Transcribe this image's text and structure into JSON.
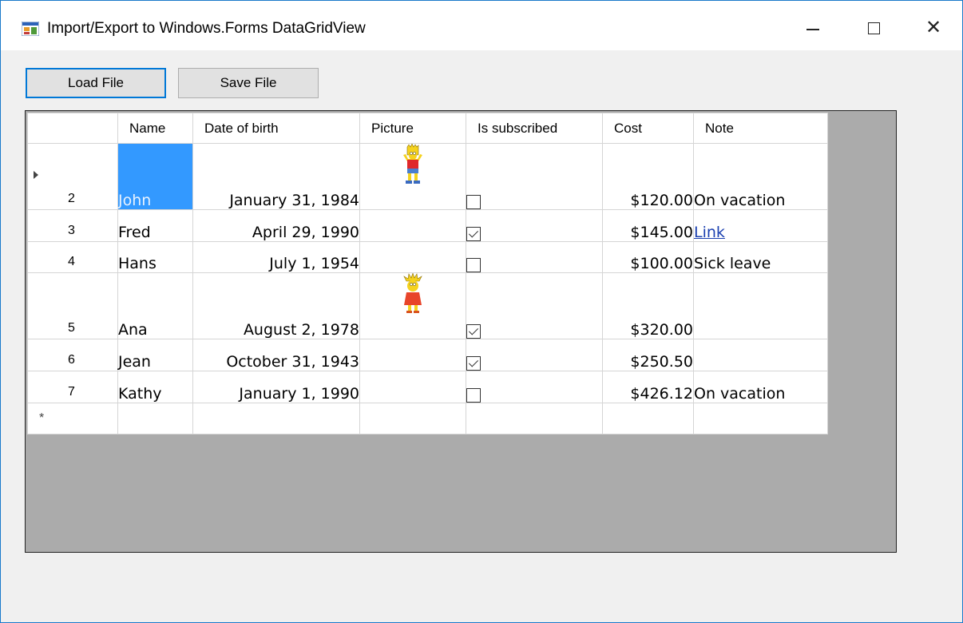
{
  "window": {
    "title": "Import/Export to Windows.Forms DataGridView",
    "icon": "form-app-icon",
    "controls": {
      "minimize": "minimize-icon",
      "maximize": "maximize-icon",
      "close": "close-icon",
      "close_glyph": "✕"
    }
  },
  "toolbar": {
    "load_label": "Load File",
    "save_label": "Save File"
  },
  "grid": {
    "columns": [
      "Name",
      "Date of birth",
      "Picture",
      "Is subscribed",
      "Cost",
      "Note"
    ],
    "new_row_marker": "*",
    "rows": [
      {
        "num": "2",
        "name": "John",
        "dob": "January 31, 1984",
        "picture": "bart-simpson-icon",
        "subscribed": false,
        "cost": "$120.00",
        "note": "On vacation",
        "note_style": "green",
        "current": true
      },
      {
        "num": "3",
        "name": "Fred",
        "dob": "April 29, 1990",
        "picture": "",
        "subscribed": true,
        "cost": "$145.00",
        "note": "Link",
        "note_style": "link"
      },
      {
        "num": "4",
        "name": "Hans",
        "dob": "July 1, 1954",
        "picture": "",
        "subscribed": false,
        "cost": "$100.00",
        "note": "Sick leave",
        "note_style": "red"
      },
      {
        "num": "5",
        "name": "Ana",
        "dob": "August 2, 1978",
        "picture": "lisa-simpson-icon",
        "subscribed": true,
        "cost": "$320.00",
        "note": "",
        "note_style": ""
      },
      {
        "num": "6",
        "name": "Jean",
        "dob": "October 31, 1943",
        "picture": "",
        "subscribed": true,
        "cost": "$250.50",
        "note": "",
        "note_style": ""
      },
      {
        "num": "7",
        "name": "Kathy",
        "dob": "January 1, 1990",
        "picture": "",
        "subscribed": false,
        "cost": "$426.12",
        "note": "On vacation",
        "note_style": "green"
      }
    ]
  },
  "colors": {
    "selection": "#3399ff",
    "grid_background": "#ababab",
    "note_green": "#29a85a",
    "note_red": "#d42a2a",
    "note_link": "#1a3fb0",
    "window_border": "#1979ca"
  }
}
